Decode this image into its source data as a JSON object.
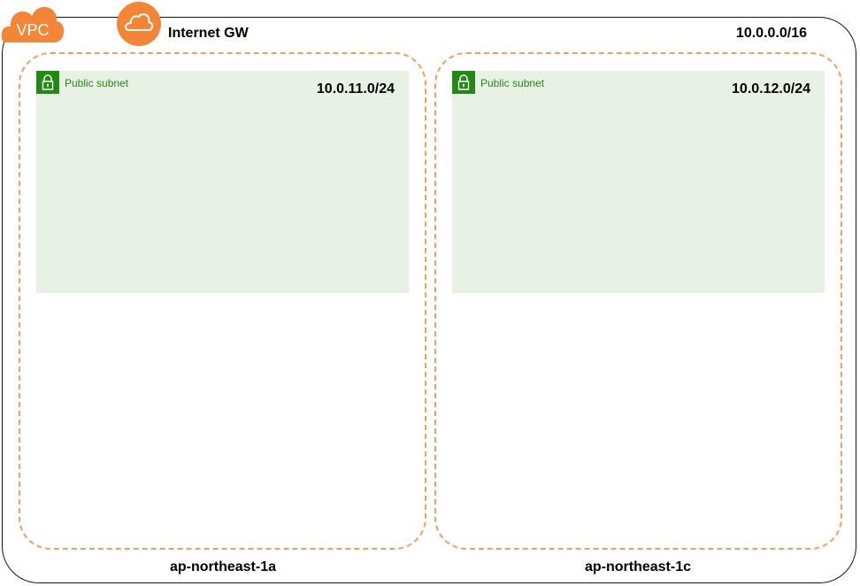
{
  "vpc": {
    "badge": "VPC",
    "cidr": "10.0.0.0/16"
  },
  "internet_gateway": {
    "label": "Internet GW",
    "icon": "cloud-icon"
  },
  "availability_zones": [
    {
      "name": "ap-northeast-1a",
      "subnet": {
        "label": "Public subnet",
        "cidr": "10.0.11.0/24",
        "icon": "lock-icon"
      }
    },
    {
      "name": "ap-northeast-1c",
      "subnet": {
        "label": "Public subnet",
        "cidr": "10.0.12.0/24",
        "icon": "lock-icon"
      }
    }
  ],
  "colors": {
    "aws_orange": "#f58536",
    "az_border": "#f0a060",
    "subnet_fill": "#e8f2e4",
    "subnet_green": "#248814",
    "vpc_border": "#111111"
  }
}
